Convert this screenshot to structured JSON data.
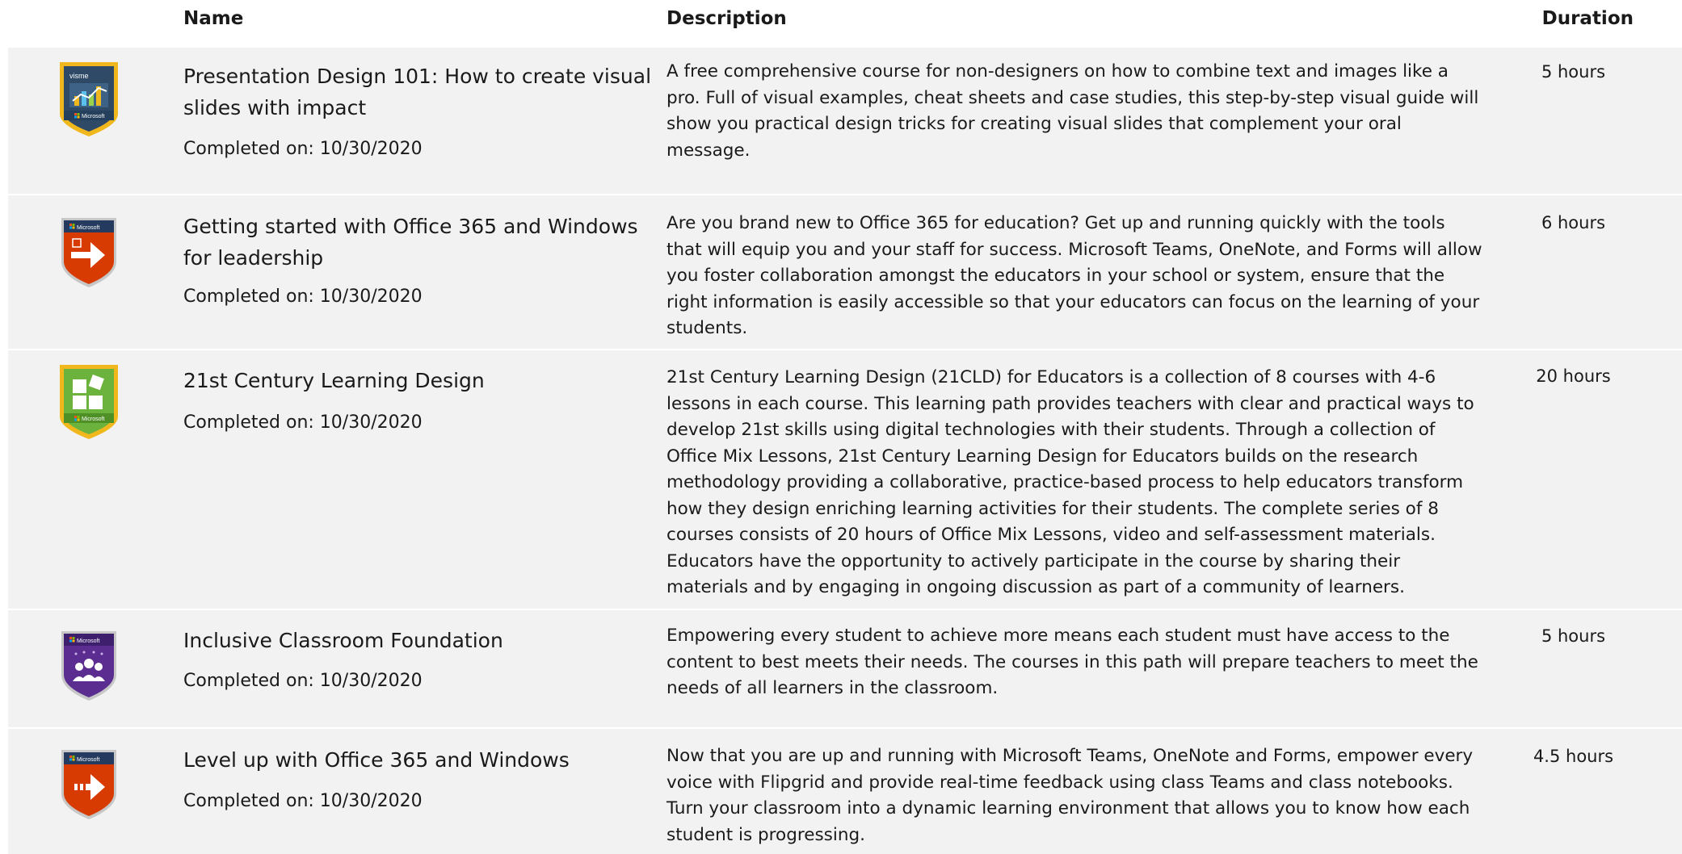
{
  "header": {
    "name_label": "Name",
    "description_label": "Description",
    "duration_label": "Duration"
  },
  "courses": [
    {
      "title": "Presentation Design 101: How to create visual slides with impact",
      "completed": "Completed on: 10/30/2020",
      "description": "A free comprehensive course for non-designers on how to combine text and images like a pro. Full of visual examples, cheat sheets and case studies, this step-by-step visual guide will show you practical design tricks for creating visual slides that complement your oral message.",
      "duration": "5 hours",
      "badge": {
        "icon": "visme-chart-badge-icon",
        "brand": "visme",
        "footer": "Microsoft",
        "color": "#2e4a66",
        "border": "#f0b81c"
      }
    },
    {
      "title": "Getting started with Office 365 and Windows for leadership",
      "completed": "Completed on: 10/30/2020",
      "description": "Are you brand new to Office 365 for education? Get up and running quickly with the tools that will equip you and your staff for success. Microsoft Teams, OneNote, and Forms will allow you foster collaboration amongst the educators in your school or system, ensure that the right information is easily accessible so that your educators can focus on the learning of your students.",
      "duration": "6 hours",
      "badge": {
        "icon": "arrow-badge-icon",
        "header": "Microsoft",
        "color": "#d83b01"
      }
    },
    {
      "title": "21st Century Learning Design",
      "completed": "Completed on: 10/30/2020",
      "description": "21st Century Learning Design (21CLD) for Educators is a collection of 8 courses with 4-6 lessons in each course. This learning path provides teachers with clear and practical ways to develop 21st skills using digital technologies with their students. Through a collection of Office Mix Lessons, 21st Century Learning Design for Educators builds on the research methodology providing a collaborative, practice-based process to help educators transform how they design enriching learning activities for their students. The complete series of 8 courses consists of 20 hours of Office Mix Lessons, video and self-assessment materials. Educators have the opportunity to actively participate in the course by sharing their materials and by engaging in ongoing discussion as part of a community of learners.",
      "duration": "20 hours",
      "badge": {
        "icon": "blocks-badge-icon",
        "footer": "Microsoft",
        "color": "#6bb33c",
        "border": "#f0b81c"
      }
    },
    {
      "title": "Inclusive Classroom Foundation",
      "completed": "Completed on: 10/30/2020",
      "description": "Empowering every student to achieve more means each student must have access to the content to best meets their needs. The courses in this path will prepare teachers to meet the needs of all learners in the classroom.",
      "duration": "5 hours",
      "badge": {
        "icon": "people-badge-icon",
        "header": "Microsoft",
        "color": "#5c2d91"
      }
    },
    {
      "title": "Level up with Office 365 and Windows",
      "completed": "Completed on: 10/30/2020",
      "description": "Now that you are up and running with Microsoft Teams, OneNote and Forms, empower every voice with Flipgrid and provide real-time feedback using class Teams and class notebooks. Turn your classroom into a dynamic learning environment that allows you to know how each student is progressing.",
      "duration": "4.5 hours",
      "badge": {
        "icon": "arrow-badge-icon",
        "header": "Microsoft",
        "color": "#d83b01"
      }
    }
  ]
}
